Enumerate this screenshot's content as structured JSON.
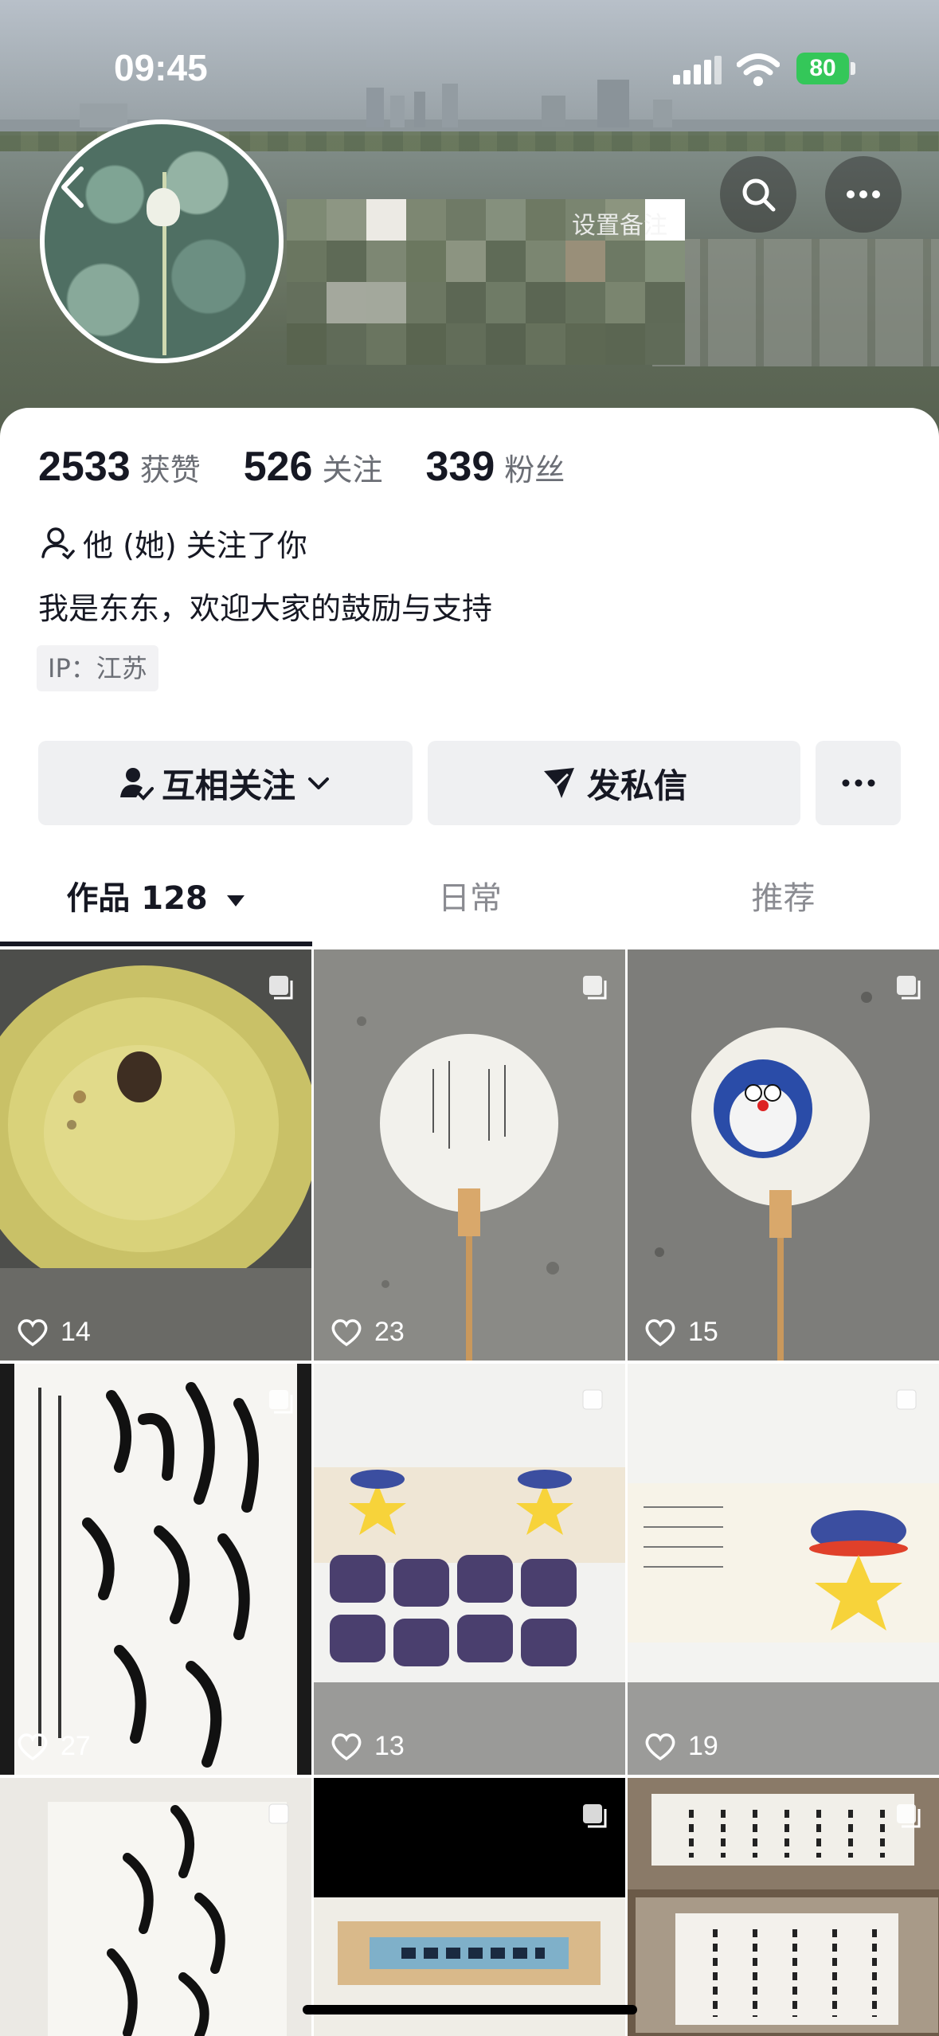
{
  "status_bar": {
    "time": "09:45",
    "battery": "80"
  },
  "profile": {
    "remark": "设置备注",
    "stats": [
      {
        "value": "2533",
        "label": "获赞"
      },
      {
        "value": "526",
        "label": "关注"
      },
      {
        "value": "339",
        "label": "粉丝"
      }
    ],
    "follows_you": "他 (她) 关注了你",
    "bio": "我是东东，欢迎大家的鼓励与支持",
    "ip": "IP：江苏"
  },
  "actions": {
    "mutual_follow": "互相关注",
    "message": "发私信"
  },
  "tabs": [
    {
      "label": "作品 128"
    },
    {
      "label": "日常"
    },
    {
      "label": "推荐"
    }
  ],
  "posts": [
    {
      "likes": "14"
    },
    {
      "likes": "23"
    },
    {
      "likes": "15"
    },
    {
      "likes": "27"
    },
    {
      "likes": "13"
    },
    {
      "likes": "19"
    }
  ],
  "colors": {
    "accent_dark": "#161823",
    "battery": "#34c759",
    "button_bg": "#eff0f2"
  },
  "icons": [
    "back-icon",
    "search-icon",
    "more-icon",
    "user-icon",
    "chevron-down-icon",
    "send-icon",
    "heart-icon",
    "multi-image-icon",
    "caret-down-icon"
  ]
}
